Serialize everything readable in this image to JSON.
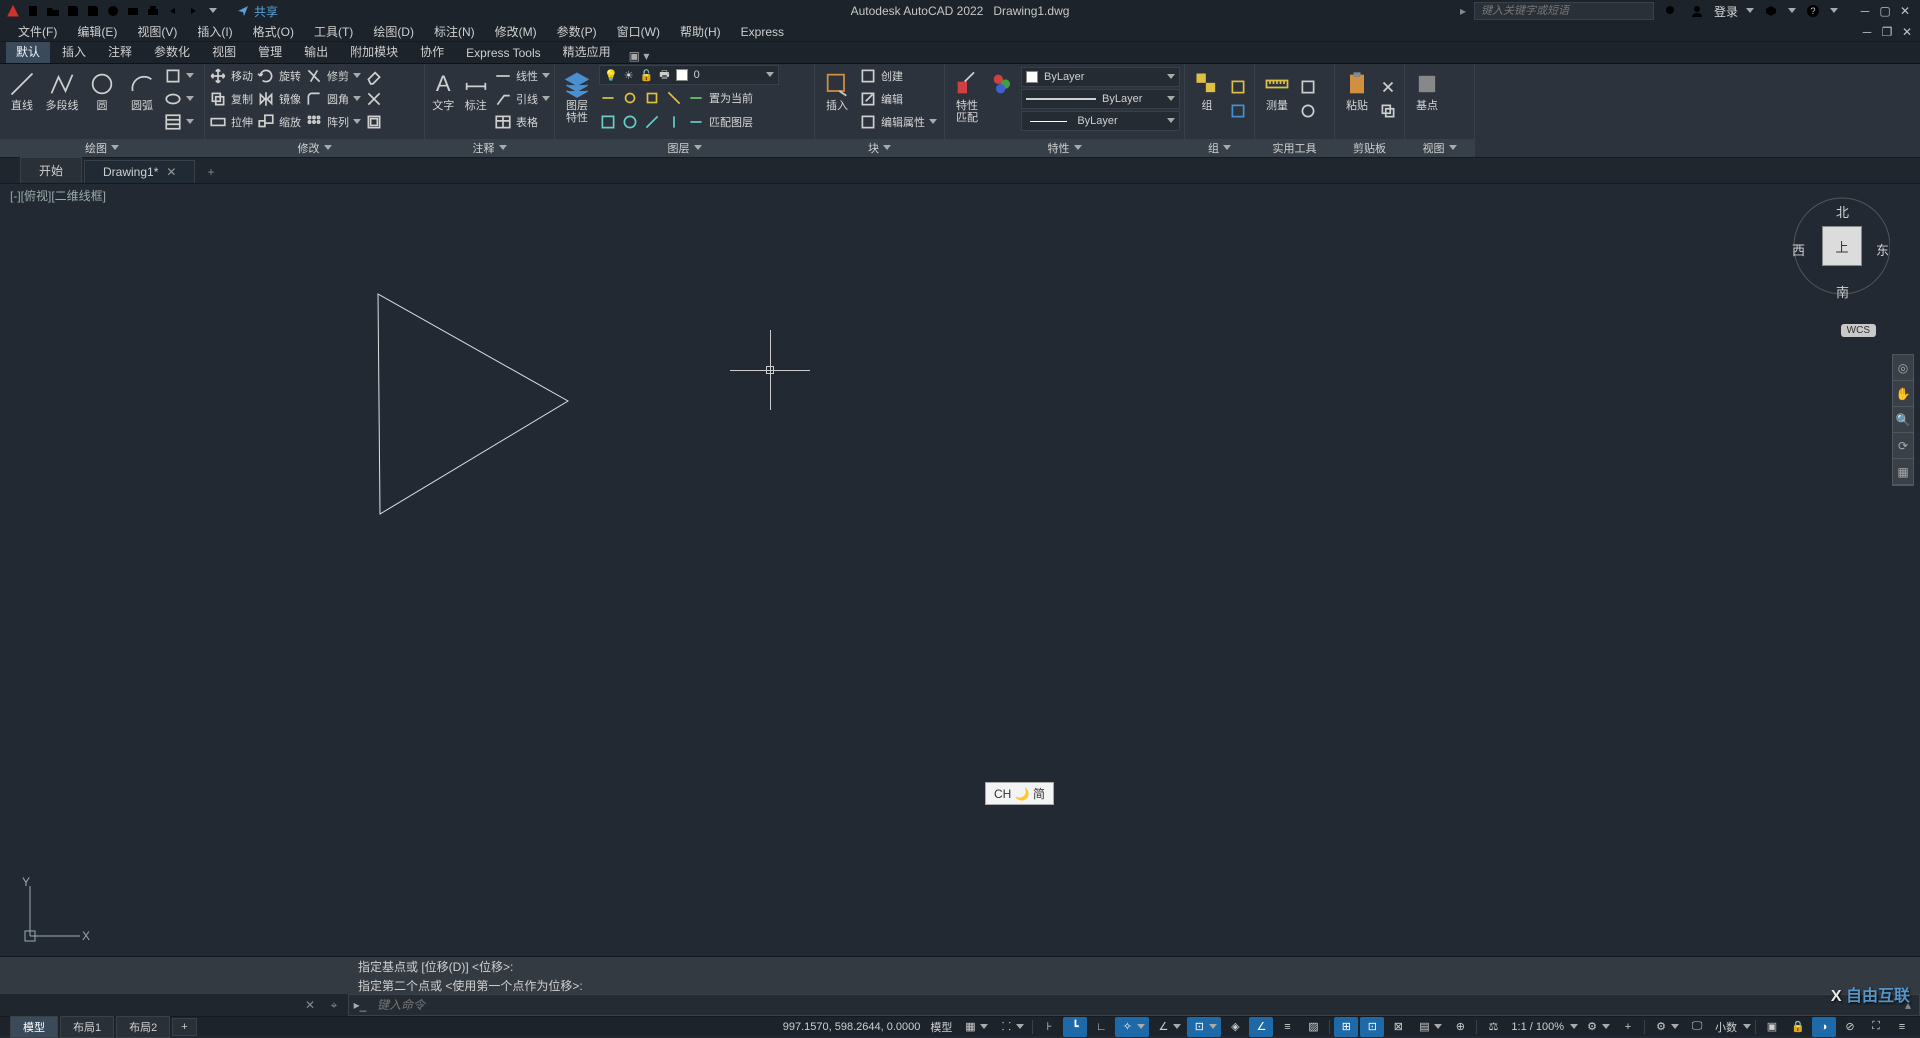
{
  "app": {
    "title": "Autodesk AutoCAD 2022",
    "document": "Drawing1.dwg"
  },
  "qat_share": "共享",
  "search": {
    "placeholder": "键入关键字或短语"
  },
  "account": {
    "label": "登录"
  },
  "menus": [
    "文件(F)",
    "编辑(E)",
    "视图(V)",
    "插入(I)",
    "格式(O)",
    "工具(T)",
    "绘图(D)",
    "标注(N)",
    "修改(M)",
    "参数(P)",
    "窗口(W)",
    "帮助(H)",
    "Express"
  ],
  "ribbon_tabs": [
    "默认",
    "插入",
    "注释",
    "参数化",
    "视图",
    "管理",
    "输出",
    "附加模块",
    "协作",
    "Express Tools",
    "精选应用"
  ],
  "ribbon_active": 0,
  "panels": {
    "draw": {
      "title": "绘图",
      "line": "直线",
      "polyline": "多段线",
      "circle": "圆",
      "arc": "圆弧"
    },
    "modify": {
      "title": "修改",
      "move": "移动",
      "rotate": "旋转",
      "trim": "修剪",
      "copy": "复制",
      "mirror": "镜像",
      "fillet": "圆角",
      "stretch": "拉伸",
      "scale": "缩放",
      "array": "阵列"
    },
    "annotation": {
      "title": "注释",
      "text": "文字",
      "dim": "标注",
      "linear": "线性",
      "leader": "引线",
      "table": "表格"
    },
    "layers": {
      "title": "图层",
      "props": "图层\n特性",
      "current_layer": "0",
      "set_current": "置为当前",
      "match": "匹配图层"
    },
    "block": {
      "title": "块",
      "insert": "插入",
      "create": "创建",
      "edit": "编辑",
      "editattr": "编辑属性"
    },
    "properties": {
      "title": "特性",
      "match": "特性\n匹配",
      "color": "ByLayer",
      "linetype": "ByLayer",
      "lineweight": "ByLayer"
    },
    "group": {
      "title": "组",
      "group": "组"
    },
    "utilities": {
      "title": "实用工具",
      "measure": "测量"
    },
    "clipboard": {
      "title": "剪贴板",
      "paste": "粘贴"
    },
    "base": {
      "title": "视图",
      "base": "基点"
    }
  },
  "filetabs": {
    "start": "开始",
    "drawing": "Drawing1*"
  },
  "viewport_label": "[-][俯视][二维线框]",
  "viewcube": {
    "top": "上",
    "n": "北",
    "s": "南",
    "e": "东",
    "w": "西",
    "wcs": "WCS"
  },
  "ime": "CH 🌙 简",
  "cmd_history": [
    "指定基点或 [位移(D)] <位移>:",
    "指定第二个点或 <使用第一个点作为位移>:"
  ],
  "cmd_placeholder": "键入命令",
  "layout_tabs": [
    "模型",
    "布局1",
    "布局2"
  ],
  "status": {
    "coords": "997.1570, 598.2644, 0.0000",
    "model": "模型",
    "scale": "1:1 / 100%",
    "decimal": "小数"
  },
  "watermark": "自由互联"
}
